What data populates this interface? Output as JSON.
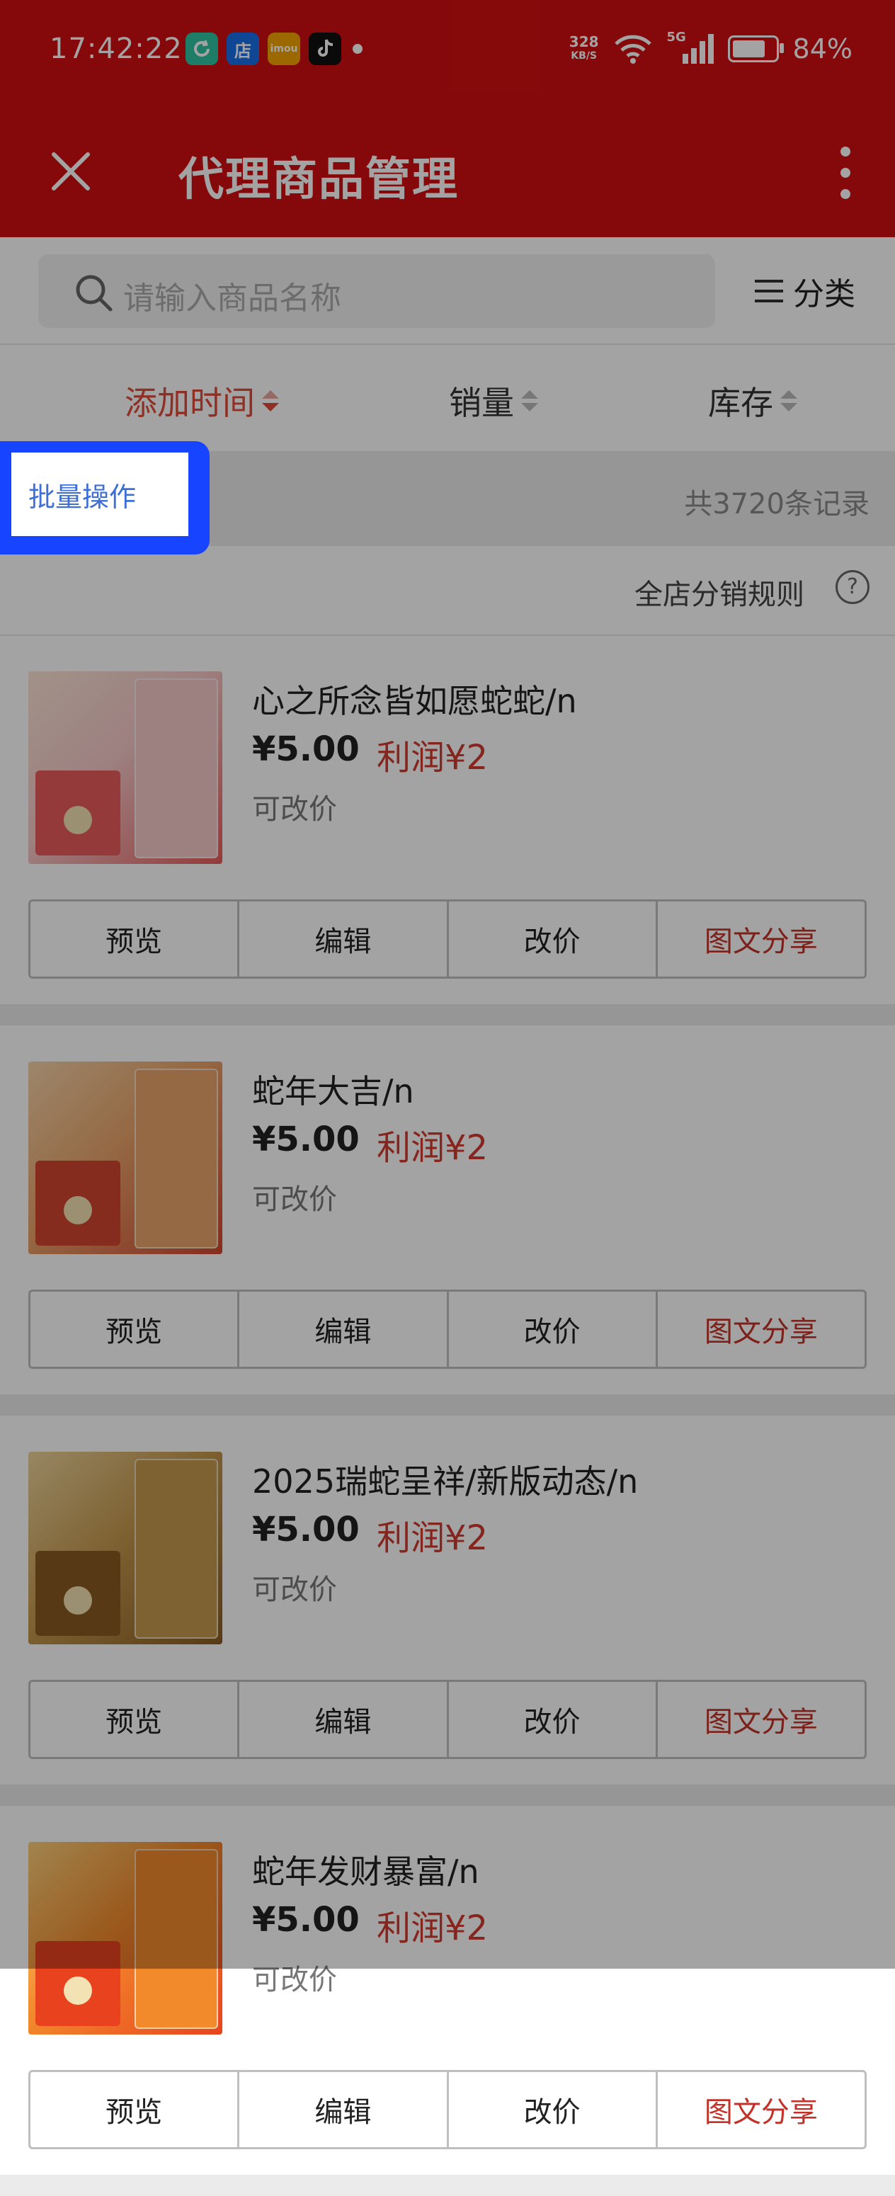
{
  "status_bar": {
    "time": "17:42:22",
    "app_icons": [
      "refresh-app-icon",
      "store-app-icon",
      "imou-app-icon",
      "tiktok-app-icon"
    ],
    "app_icon_labels": [
      "",
      "店",
      "imou",
      ""
    ],
    "net_speed_value": "328",
    "net_speed_unit": "KB/S",
    "network": "5G",
    "battery": "84%",
    "battery_level": 0.84
  },
  "header": {
    "title": "代理商品管理",
    "close_icon": "close-icon",
    "more_icon": "more-vertical-icon"
  },
  "search": {
    "placeholder": "请输入商品名称",
    "category_label": "分类"
  },
  "sort": {
    "items": [
      {
        "label": "添加时间",
        "active": true
      },
      {
        "label": "销量",
        "active": false
      },
      {
        "label": "库存",
        "active": false
      }
    ]
  },
  "batch": {
    "label": "批量操作",
    "record_count": "共3720条记录"
  },
  "rules": {
    "label": "全店分销规则",
    "help": "?"
  },
  "actions_labels": [
    "预览",
    "编辑",
    "改价",
    "图文分享"
  ],
  "products": [
    {
      "title": "心之所念皆如愿蛇蛇/n",
      "price": "¥5.00",
      "profit": "利润¥2",
      "price_note": "可改价"
    },
    {
      "title": "蛇年大吉/n",
      "price": "¥5.00",
      "profit": "利润¥2",
      "price_note": "可改价"
    },
    {
      "title": "2025瑞蛇呈祥/新版动态/n",
      "price": "¥5.00",
      "profit": "利润¥2",
      "price_note": "可改价"
    },
    {
      "title": "蛇年发财暴富/n",
      "price": "¥5.00",
      "profit": "利润¥2",
      "price_note": "可改价"
    }
  ],
  "colors": {
    "header_red": "#d10f10",
    "active_sort": "#e24a37",
    "profit_red": "#d23b2e",
    "highlight_blue": "#1744ff",
    "link_blue": "#3d6fd6"
  }
}
